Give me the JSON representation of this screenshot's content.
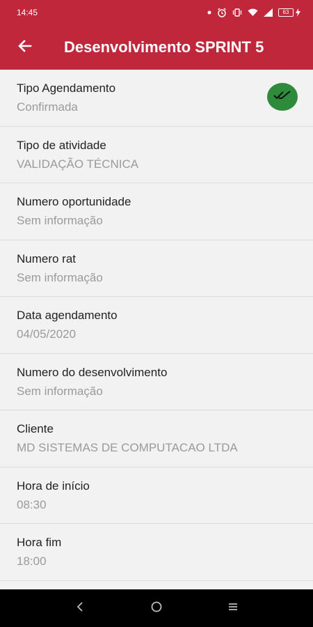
{
  "status_bar": {
    "time": "14:45",
    "battery": "63"
  },
  "app_bar": {
    "title": "Desenvolvimento SPRINT 5"
  },
  "fields": [
    {
      "label": "Tipo Agendamento",
      "value": "Confirmada"
    },
    {
      "label": "Tipo de atividade",
      "value": "VALIDAÇÃO TÉCNICA"
    },
    {
      "label": "Numero oportunidade",
      "value": "Sem informação"
    },
    {
      "label": "Numero rat",
      "value": "Sem informação"
    },
    {
      "label": "Data agendamento",
      "value": "04/05/2020"
    },
    {
      "label": "Numero do desenvolvimento",
      "value": "Sem informação"
    },
    {
      "label": "Cliente",
      "value": "MD SISTEMAS DE COMPUTACAO LTDA"
    },
    {
      "label": "Hora de início",
      "value": "08:30"
    },
    {
      "label": "Hora fim",
      "value": "18:00"
    }
  ],
  "colors": {
    "primary": "#c0273a",
    "confirmed_badge": "#2e8b3c",
    "background": "#f2f2f2"
  }
}
